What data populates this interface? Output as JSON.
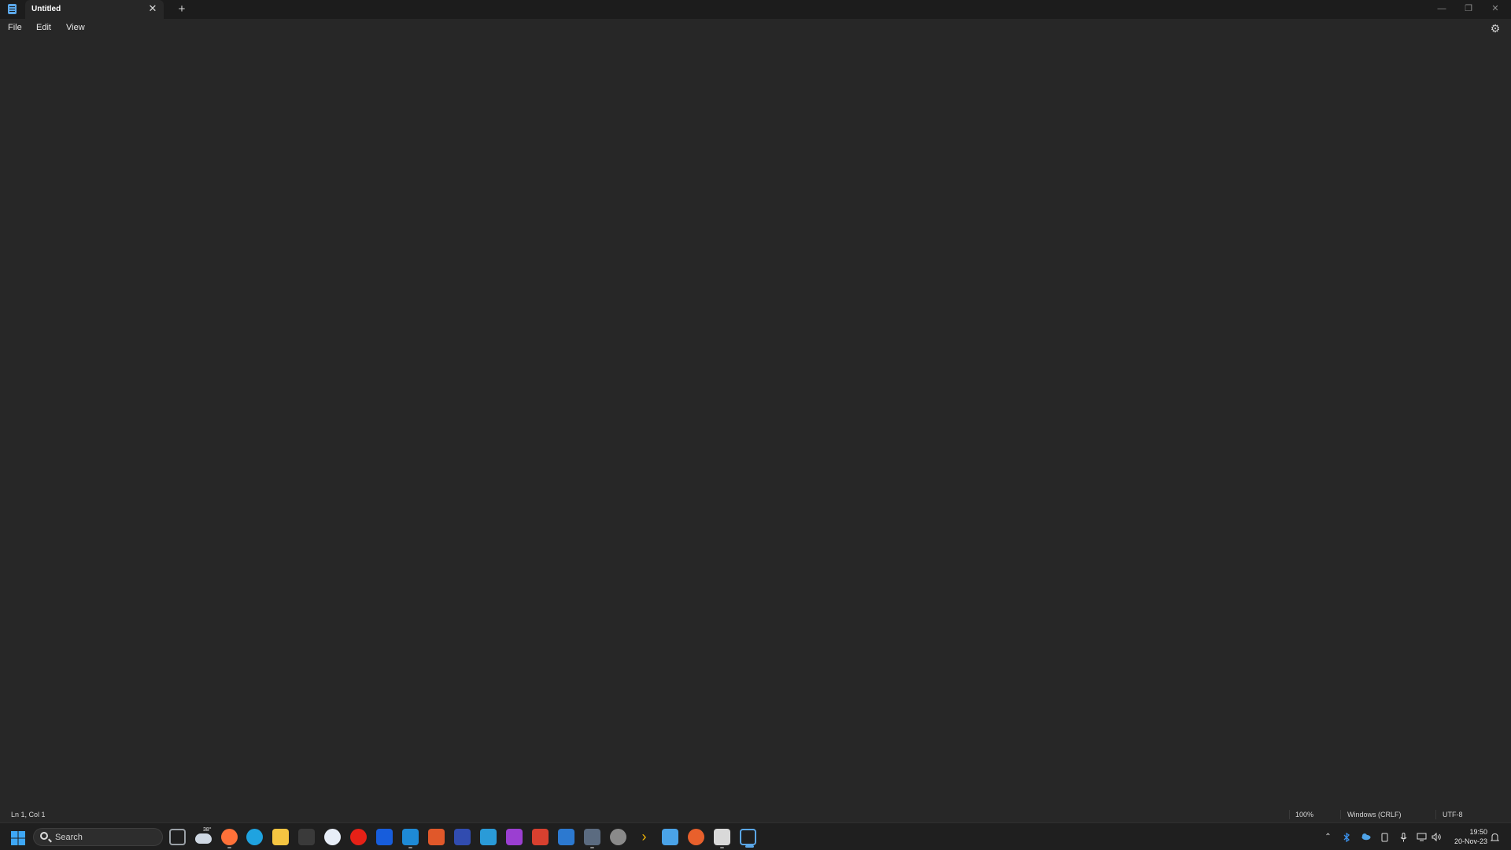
{
  "window": {
    "tab_title": "Untitled",
    "tab_close_glyph": "✕",
    "new_tab_glyph": "+",
    "minimize_glyph": "—",
    "restore_glyph": "❐",
    "close_glyph": "✕"
  },
  "menu": {
    "file": "File",
    "edit": "Edit",
    "view": "View",
    "settings_glyph": "⚙"
  },
  "editor": {
    "content": ""
  },
  "status": {
    "position": "Ln 1, Col 1",
    "zoom": "100%",
    "line_endings": "Windows (CRLF)",
    "encoding": "UTF-8"
  },
  "taskbar": {
    "search_label": "Search",
    "weather_temp": "38°",
    "pinned": [
      {
        "name": "task-view-icon",
        "color": "#9aa0a6"
      },
      {
        "name": "weather-icon",
        "color": "#cfd8e3"
      },
      {
        "name": "firefox-icon",
        "color": "#ff7139"
      },
      {
        "name": "edge-icon",
        "color": "#1fa3e0"
      },
      {
        "name": "file-explorer-icon",
        "color": "#f5c542"
      },
      {
        "name": "terminal-icon",
        "color": "#3a3a3a"
      },
      {
        "name": "app-circle-icon",
        "color": "#e8eef8"
      },
      {
        "name": "youtube-music-icon",
        "color": "#e62117"
      },
      {
        "name": "bitwarden-icon",
        "color": "#175ddc"
      },
      {
        "name": "vscode-icon",
        "color": "#1e8ad6"
      },
      {
        "name": "office-icon",
        "color": "#e0582a"
      },
      {
        "name": "kicad-icon",
        "color": "#314cb0"
      },
      {
        "name": "affinity-designer-icon",
        "color": "#2a9bd8"
      },
      {
        "name": "affinity-photo-icon",
        "color": "#9b3fd1"
      },
      {
        "name": "affinity-publisher-icon",
        "color": "#d8402f"
      },
      {
        "name": "c-app-icon",
        "color": "#2c79d0"
      },
      {
        "name": "davinci-icon",
        "color": "#5b6b80"
      },
      {
        "name": "obs-icon",
        "color": "#8a8a8a"
      },
      {
        "name": "chevron-app-icon",
        "color": "#f2b705"
      },
      {
        "name": "store-icon",
        "color": "#4aa3e8"
      },
      {
        "name": "orange-circle-app-icon",
        "color": "#e8602c"
      },
      {
        "name": "remote-desktop-icon",
        "color": "#d9d9d9"
      },
      {
        "name": "notepad-icon",
        "color": "#5ba7e8"
      }
    ],
    "tray_up_glyph": "⌃",
    "clock_time": "19:50",
    "clock_date": "20-Nov-23"
  },
  "colors": {
    "accent": "#5ba7e8",
    "background": "#272727",
    "titlebar": "#1c1c1c",
    "taskbar": "#1f1f1f"
  }
}
